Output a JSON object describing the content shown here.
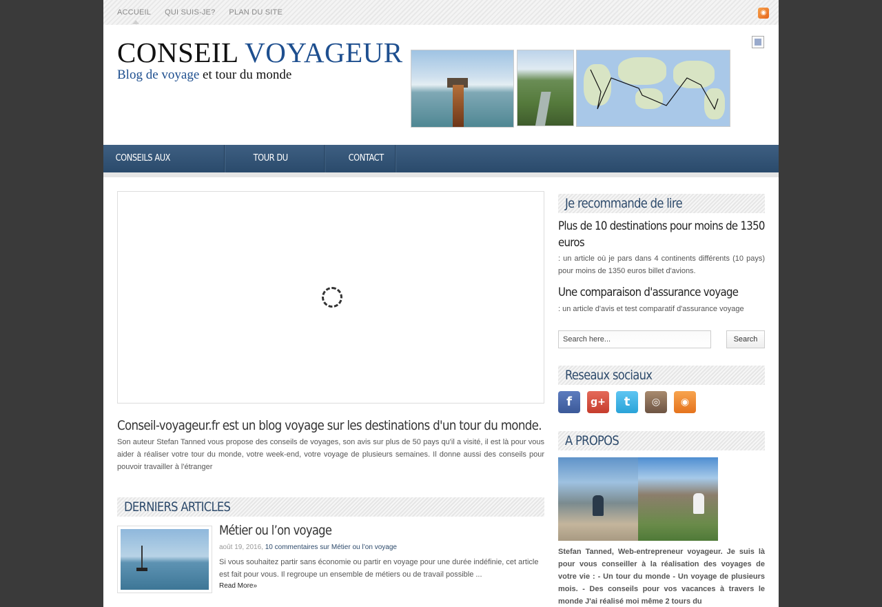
{
  "topnav": {
    "items": [
      "ACCUEIL",
      "QUI SUIS-JE?",
      "PLAN DU SITE"
    ]
  },
  "header": {
    "logo_word1": "CONSEIL",
    "logo_word2": "VOYAGEUR",
    "tagline_part1": "Blog de voyage",
    "tagline_part2": "et tour du monde"
  },
  "mainnav": {
    "items": [
      "CONSEILS AUX VOYAGEURS",
      "TOUR DU MONDE",
      "CONTACT"
    ]
  },
  "intro": {
    "title": "Conseil-voyageur.fr est un blog voyage sur les destinations d'un tour du monde.",
    "text": "Son auteur Stefan Tanned vous propose des conseils de voyages, son avis sur plus de 50 pays qu'il a visité, il est là pour vous aider à réaliser votre tour du monde, votre week-end, votre voyage de plusieurs semaines. Il donne aussi des conseils pour pouvoir travailler à l'étranger"
  },
  "articles": {
    "heading": "DERNIERS ARTICLES",
    "post": {
      "title": "Métier ou l’on voyage",
      "date": "août 19, 2016,",
      "comments": "10 commentaires sur Métier ou l’on voyage",
      "excerpt": "Si vous souhaitez partir sans économie ou partir en voyage pour une durée indéfinie, cet article est fait pour vous. Il regroupe un ensemble de métiers ou de travail possible ...",
      "read_more": "Read More»"
    }
  },
  "sidebar": {
    "reco_heading": "Je recommande de lire",
    "reco1_title_line1": "Plus de 10 destinations pour moins de 1350",
    "reco1_title_line2": "euros",
    "reco1_text": ": un article où je pars dans 4 continents différents (10 pays) pour moins de 1350 euros billet d'avions.",
    "reco2_title": "Une comparaison d'assurance voyage",
    "reco2_text": ": un article d'avis et test comparatif d'assurance voyage",
    "search_placeholder": "Search here...",
    "search_button": "Search",
    "social_heading": "Reseaux sociaux",
    "about_heading": "A PROPOS",
    "about_text": "Stefan Tanned, Web-entrepreneur voyageur. Je suis là pour vous conseiller à la réalisation des voyages de votre vie : - Un tour du monde - Un voyage de plusieurs mois.  - Des conseils pour vos vacances à travers le monde J'ai réalisé moi même 2 tours du"
  },
  "colors": {
    "nav_blue": "#2a4a6b",
    "heading_blue": "#2d4a6b",
    "logo_blue": "#1e4f8f"
  }
}
